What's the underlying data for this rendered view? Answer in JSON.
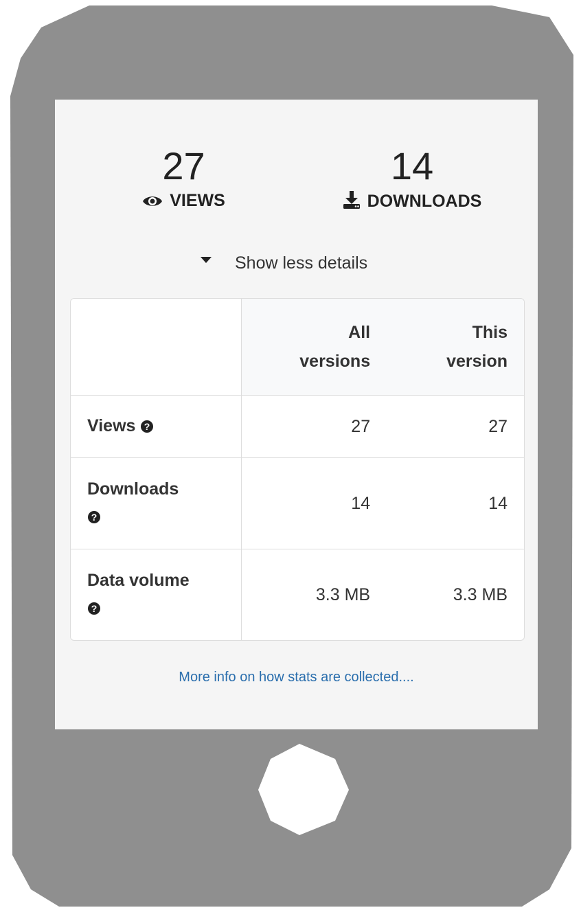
{
  "colors": {
    "phone_body": "#8f8f8f",
    "screen_bg": "#f5f5f5",
    "link": "#2a6ead",
    "home_button": "#ffffff"
  },
  "stats": {
    "views": {
      "value": "27",
      "label": "VIEWS",
      "icon": "eye-icon"
    },
    "downloads": {
      "value": "14",
      "label": "DOWNLOADS",
      "icon": "download-icon"
    }
  },
  "toggle": {
    "label": "Show less details",
    "icon": "caret-down-icon"
  },
  "table": {
    "headers": [
      "",
      "All versions",
      "This version"
    ],
    "rows": [
      {
        "label": "Views",
        "all": "27",
        "this": "27",
        "icon": "question-circle-icon"
      },
      {
        "label": "Downloads",
        "all": "14",
        "this": "14",
        "icon": "question-circle-icon"
      },
      {
        "label": "Data volume",
        "all": "3.3 MB",
        "this": "3.3 MB",
        "icon": "question-circle-icon"
      }
    ]
  },
  "more_info": {
    "label": "More info on how stats are collected...."
  }
}
